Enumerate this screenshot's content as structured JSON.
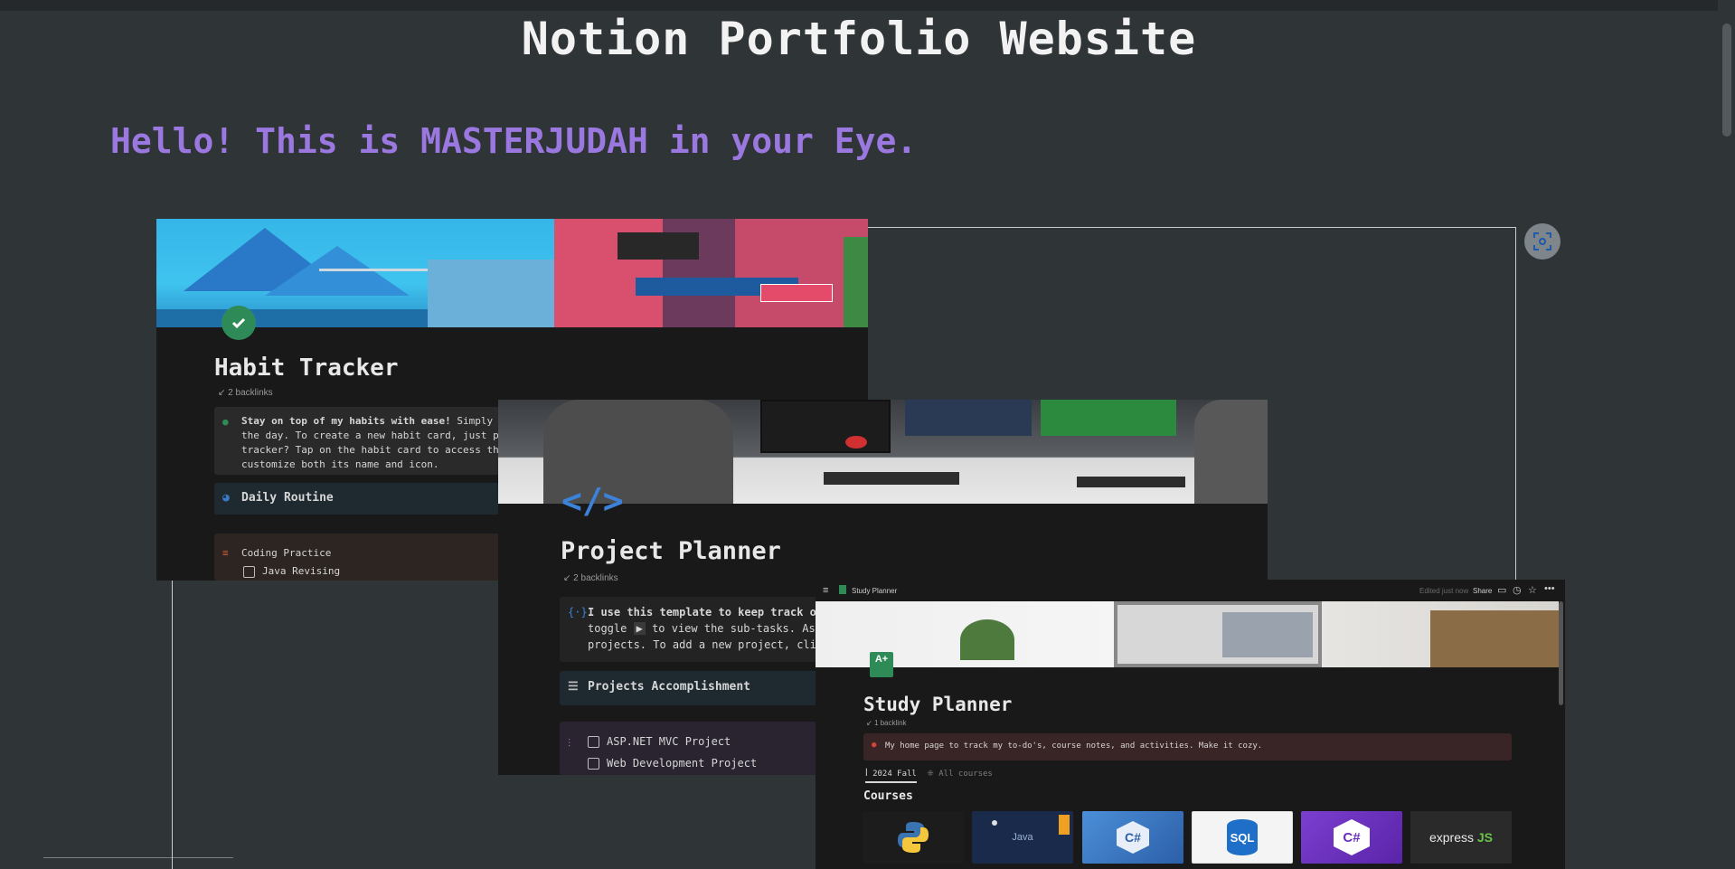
{
  "page": {
    "title": "Notion Portfolio Website",
    "greeting": "Hello! This is MASTERJUDAH in your Eye."
  },
  "colors": {
    "background": "#2f3437",
    "greeting": "#9a78e0",
    "card": "#191919"
  },
  "habit": {
    "title": "Habit Tracker",
    "backlinks": "2 backlinks",
    "callout_bold": "Stay on top of my habits with ease!",
    "callout_lines": [
      " Simply t",
      "the day. To create a new habit card, just pr",
      "tracker? Tap on the habit card to access the",
      "customize both its name and icon."
    ],
    "section": "Daily Routine",
    "item_title": "Coding Practice",
    "subitem": "Java Revising",
    "icons": [
      "check-badge-icon",
      "bulb-icon",
      "clock-icon",
      "abacus-icon"
    ]
  },
  "project": {
    "title": "Project Planner",
    "backlinks": "2 backlinks",
    "callout_lines": [
      "I use this template to keep track of",
      "toggle",
      "to view the sub-tasks. Ass",
      "projects. To add a new project, clic"
    ],
    "section": "Projects Accomplishment",
    "items": [
      "ASP.NET MVC Project",
      "Web Development Project"
    ],
    "icons": [
      "code-icon",
      "braces-icon",
      "checklist-icon",
      "sliders-icon"
    ]
  },
  "study": {
    "topbar_title": "Study Planner",
    "edited": "Edited just now",
    "share": "Share",
    "title": "Study Planner",
    "backlinks": "1 backlink",
    "callout": "My home page to track my to-do's, course notes, and activities. Make it cozy.",
    "tabs": [
      "2024 Fall",
      "All courses"
    ],
    "section": "Courses",
    "courses": [
      {
        "name": "python-logo",
        "label": ""
      },
      {
        "name": "java-logo",
        "label": "Java"
      },
      {
        "name": "c-sharp-logo",
        "label": "C#"
      },
      {
        "name": "sql-logo",
        "label": "SQL"
      },
      {
        "name": "c-sharp-purple-logo",
        "label": "C#"
      },
      {
        "name": "express-js-logo",
        "label": "express"
      }
    ],
    "icons": [
      "menu-icon",
      "page-icon",
      "comment-icon",
      "clock-icon",
      "star-icon",
      "more-icon",
      "grade-icon"
    ]
  }
}
